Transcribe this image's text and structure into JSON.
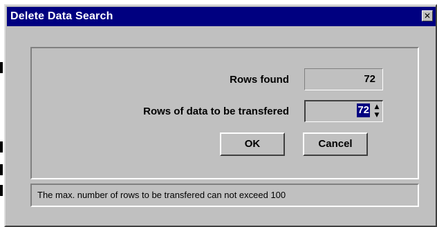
{
  "window": {
    "title": "Delete Data Search",
    "close_icon": "close-icon"
  },
  "form": {
    "rows_found_label": "Rows found",
    "rows_found_value": "72",
    "rows_to_transfer_label": "Rows of data to be transfered",
    "rows_to_transfer_value": "72"
  },
  "buttons": {
    "ok_label": "OK",
    "cancel_label": "Cancel"
  },
  "status": {
    "message": "The max. number of rows to be transfered can not exceed 100"
  },
  "colors": {
    "title_bar": "#000080",
    "face": "#c0c0c0",
    "selection": "#000080"
  }
}
